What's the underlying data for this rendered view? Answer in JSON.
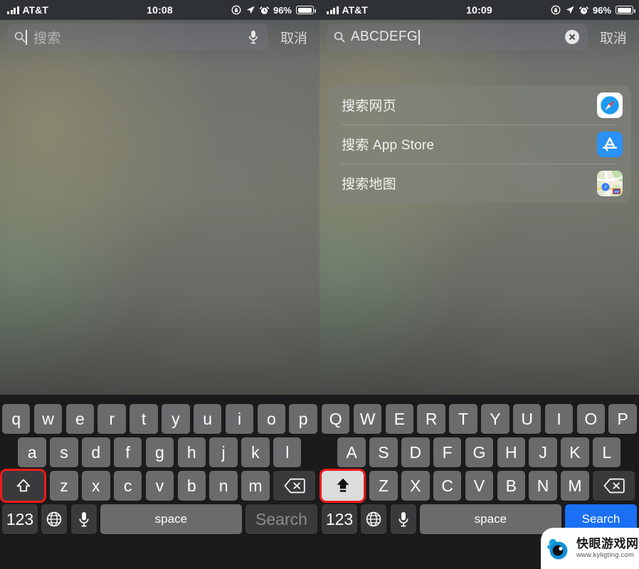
{
  "screens": [
    {
      "id": "left",
      "status_bar": {
        "carrier": "AT&T",
        "time": "10:08",
        "battery_percent": "96%",
        "icons": [
          "signal-bars-icon",
          "rotation-lock-icon",
          "location-arrow-icon",
          "alarm-clock-icon",
          "battery-icon"
        ]
      },
      "search": {
        "value": "",
        "placeholder": "搜索",
        "cancel_label": "取消",
        "has_mic": true,
        "has_clear": false
      },
      "suggestions": [],
      "keyboard": {
        "case": "lowercase",
        "shift_active": false,
        "shift_highlighted": true,
        "row1": [
          "q",
          "w",
          "e",
          "r",
          "t",
          "y",
          "u",
          "i",
          "o",
          "p"
        ],
        "row2": [
          "a",
          "s",
          "d",
          "f",
          "g",
          "h",
          "j",
          "k",
          "l"
        ],
        "row3": [
          "z",
          "x",
          "c",
          "v",
          "b",
          "n",
          "m"
        ],
        "numeric_label": "123",
        "space_label": "space",
        "return_label": "Search",
        "return_enabled": false
      }
    },
    {
      "id": "right",
      "status_bar": {
        "carrier": "AT&T",
        "time": "10:09",
        "battery_percent": "96%",
        "icons": [
          "signal-bars-icon",
          "rotation-lock-icon",
          "location-arrow-icon",
          "alarm-clock-icon",
          "battery-icon"
        ]
      },
      "search": {
        "value": "ABCDEFG",
        "placeholder": "搜索",
        "cancel_label": "取消",
        "has_mic": false,
        "has_clear": true
      },
      "suggestions": [
        {
          "label": "搜索网页",
          "icon": "safari-icon"
        },
        {
          "label": "搜索 App Store",
          "icon": "app-store-icon"
        },
        {
          "label": "搜索地图",
          "icon": "maps-icon"
        }
      ],
      "keyboard": {
        "case": "uppercase",
        "shift_active": true,
        "shift_highlighted": true,
        "row1": [
          "Q",
          "W",
          "E",
          "R",
          "T",
          "Y",
          "U",
          "I",
          "O",
          "P"
        ],
        "row2": [
          "A",
          "S",
          "D",
          "F",
          "G",
          "H",
          "J",
          "K",
          "L"
        ],
        "row3": [
          "Z",
          "X",
          "C",
          "V",
          "B",
          "N",
          "M"
        ],
        "numeric_label": "123",
        "space_label": "space",
        "return_label": "Search",
        "return_enabled": true
      }
    }
  ],
  "watermark": {
    "title": "快眼游戏网",
    "url": "www.kyligting.com"
  },
  "colors": {
    "accent_blue": "#1a6ff5",
    "highlight_red": "#f01b1b",
    "key_gray": "#6b6b6e",
    "key_dark": "#3a3a3c",
    "keyboard_bg": "#1b1b1d"
  }
}
